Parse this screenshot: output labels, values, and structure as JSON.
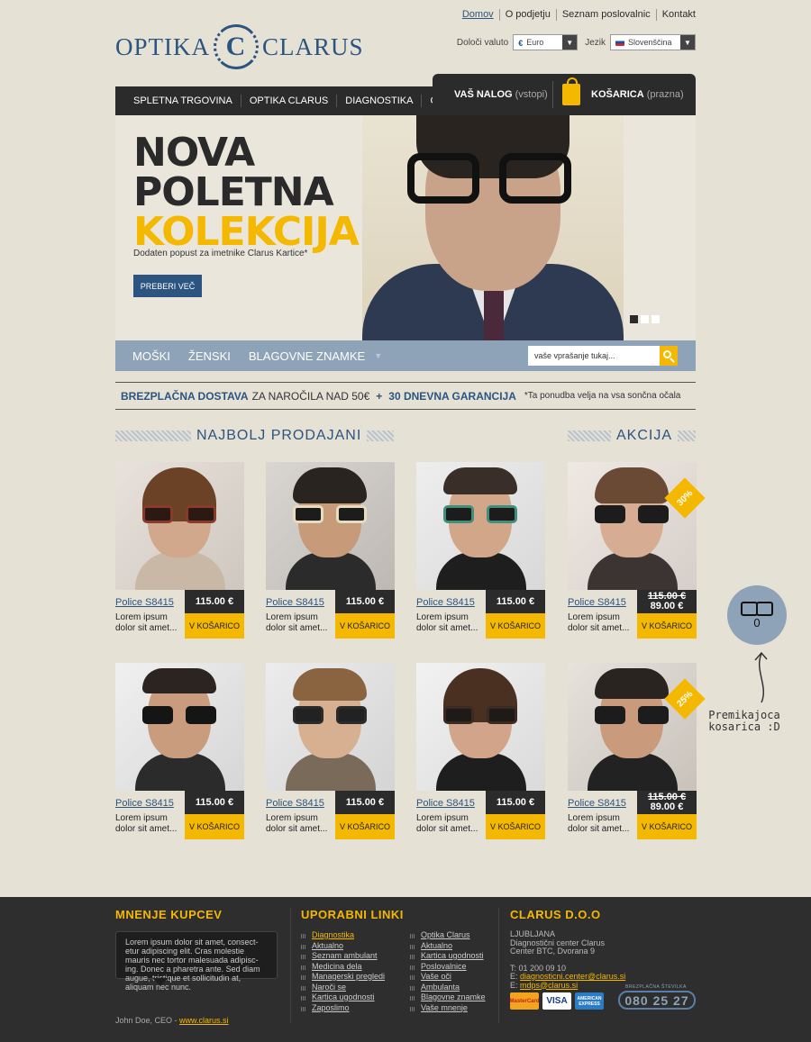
{
  "brand": {
    "left": "OPTIKA",
    "crest": "C",
    "right": "CLARUS"
  },
  "toplinks": [
    "Domov",
    "O podjetju",
    "Seznam poslovalnic",
    "Kontakt"
  ],
  "currency": {
    "label": "Določi valuto",
    "value": "Euro",
    "symbol": "€"
  },
  "language": {
    "label": "Jezik",
    "value": "Slovenščina"
  },
  "nav": [
    "SPLETNA TRGOVINA",
    "OPTIKA CLARUS",
    "DIAGNOSTIKA",
    "GOLF"
  ],
  "account": {
    "label": "VAŠ NALOG",
    "sub": "(vstopi)"
  },
  "cart": {
    "label": "KOŠARICA",
    "sub": "(prazna)"
  },
  "hero": {
    "line1": "NOVA",
    "line2": "POLETNA",
    "line3": "KOLEKCIJA",
    "subtitle": "Dodaten popust za imetnike Clarus Kartice*",
    "button": "PREBERI VEČ"
  },
  "subnav": [
    "MOŠKI",
    "ŽENSKI",
    "BLAGOVNE ZNAMKE"
  ],
  "search": {
    "placeholder": "vaše vprašanje tukaj..."
  },
  "promo": {
    "b1": "BREZPLAČNA DOSTAVA",
    "t1": "ZA NAROČILA NAD 50€",
    "plus": "+",
    "b2": "30 DNEVNA GARANCIJA",
    "note": "*Ta ponudba velja na vsa sončna očala"
  },
  "sections": {
    "bestsellers": "NAJBOLJ PRODAJANI",
    "sale": "AKCIJA"
  },
  "products": [
    {
      "name": "Police S8415",
      "price": "115.00 €",
      "desc": "Lorem ipsum dolor sit amet...",
      "button": "V KOŠARICO"
    },
    {
      "name": "Police S8415",
      "price": "115.00 €",
      "desc": "Lorem ipsum dolor sit amet...",
      "button": "V KOŠARICO"
    },
    {
      "name": "Police S8415",
      "price": "115.00 €",
      "desc": "Lorem ipsum dolor sit amet...",
      "button": "V KOŠARICO"
    },
    {
      "name": "Police S8415",
      "old": "115.00 €",
      "price": "89.00 €",
      "desc": "Lorem ipsum dolor sit amet...",
      "button": "V KOŠARICO",
      "badge": "30%"
    },
    {
      "name": "Police S8415",
      "price": "115.00 €",
      "desc": "Lorem ipsum dolor sit amet...",
      "button": "V KOŠARICO"
    },
    {
      "name": "Police S8415",
      "price": "115.00 €",
      "desc": "Lorem ipsum dolor sit amet...",
      "button": "V KOŠARICO"
    },
    {
      "name": "Police S8415",
      "price": "115.00 €",
      "desc": "Lorem ipsum dolor sit amet...",
      "button": "V KOŠARICO"
    },
    {
      "name": "Police S8415",
      "old": "115.00 €",
      "price": "89.00 €",
      "desc": "Lorem ipsum dolor sit amet...",
      "button": "V KOŠARICO",
      "badge": "25%"
    }
  ],
  "floatcart": {
    "count": "0",
    "note": "Premikajoca kosarica :D"
  },
  "footer": {
    "reviews": {
      "title": "MNENJE KUPCEV",
      "quote": "Lorem ipsum dolor sit amet, consect-etur adipiscing elit. Cras molestie mauris nec tortor malesuada adipisc-ing. Donec a pharetra ante. Sed diam augue, tristique et sollicitudin at, aliquam nec nunc.",
      "author": "John Doe, CEO - ",
      "link": "www.clarus.si"
    },
    "links": {
      "title": "UPORABNI LINKI",
      "col1": [
        "Diagnostika",
        "Aktualno",
        "Seznam ambulant",
        "Medicina dela",
        "Managerski pregledi",
        "Naroči se",
        "Kartica ugodnosti",
        "Zaposlimo"
      ],
      "col2": [
        "Optika Clarus",
        "Aktualno",
        "Kartica ugodnosti",
        "Poslovalnice",
        "Vaše oči",
        "Ambulanta",
        "Blagovne znamke",
        "Vaše mnenje"
      ]
    },
    "company": {
      "title": "CLARUS D.O.O",
      "city": "LJUBLJANA",
      "line1": "Diagnostični center Clarus",
      "line2": "Center BTC, Dvorana 9",
      "tel": "T: 01 200 09 10",
      "email1_prefix": "E: ",
      "email1": "diagnosticni.center@clarus.si",
      "email2_prefix": "E: ",
      "email2": "mdps@clarus.si",
      "cards": [
        "MasterCard",
        "VISA",
        "AMERICAN EXPRESS"
      ],
      "phone_label": "BREZPLAČNA ŠTEVILKA",
      "phone": "080 25 27"
    }
  }
}
